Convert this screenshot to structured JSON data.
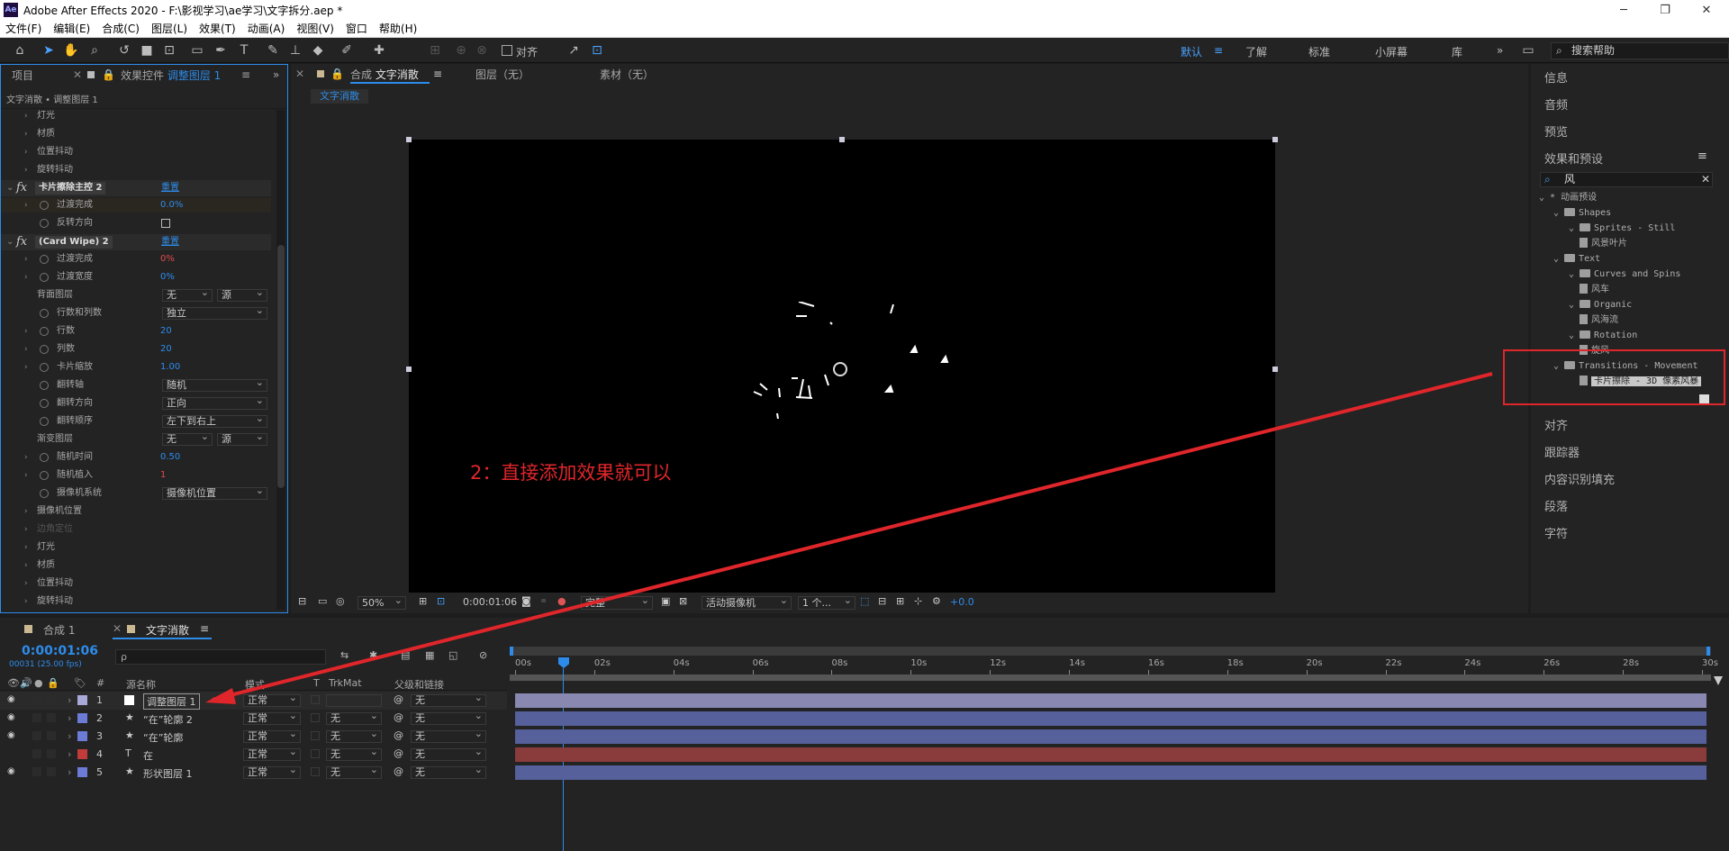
{
  "window": {
    "title": "Adobe After Effects 2020 - F:\\影视学习\\ae学习\\文字拆分.aep *",
    "logo": "Ae",
    "controls": [
      "minimize-icon",
      "restore-icon",
      "close-icon"
    ]
  },
  "menu": [
    "文件(F)",
    "编辑(E)",
    "合成(C)",
    "图层(L)",
    "效果(T)",
    "动画(A)",
    "视图(V)",
    "窗口",
    "帮助(H)"
  ],
  "toolbar": {
    "align_label": "对齐",
    "workspaces": [
      "默认",
      "了解",
      "标准",
      "小屏幕",
      "库"
    ],
    "search_help_placeholder": "搜索帮助"
  },
  "left_panel": {
    "tab_project": "项目",
    "tab_effects_prefix": "效果控件",
    "tab_effects_layer": "调整图层 1",
    "breadcrumb": "文字消散 • 调整图层 1",
    "props_top": [
      "灯光",
      "材质",
      "位置抖动",
      "旋转抖动"
    ],
    "fx1": {
      "name": "卡片擦除主控 2",
      "reset": "重置",
      "completion_label": "过渡完成",
      "completion_value": "0.0%",
      "reverse_label": "反转方向"
    },
    "fx2": {
      "name": "(Card Wipe) 2",
      "reset": "重置",
      "rows": [
        {
          "label": "过渡完成",
          "value": "0%",
          "type": "red"
        },
        {
          "label": "过渡宽度",
          "value": "0%",
          "type": "val"
        },
        {
          "label": "背面图层",
          "dd1": "无",
          "dd2": "源"
        },
        {
          "label": "行数和列数",
          "dd": "独立"
        },
        {
          "label": "行数",
          "value": "20",
          "type": "val"
        },
        {
          "label": "列数",
          "value": "20",
          "type": "val"
        },
        {
          "label": "卡片缩放",
          "value": "1.00",
          "type": "val"
        },
        {
          "label": "翻转轴",
          "dd": "随机"
        },
        {
          "label": "翻转方向",
          "dd": "正向"
        },
        {
          "label": "翻转顺序",
          "dd": "左下到右上"
        },
        {
          "label": "渐变图层",
          "dd1": "无",
          "dd2": "源"
        },
        {
          "label": "随机时间",
          "value": "0.50",
          "type": "val"
        },
        {
          "label": "随机植入",
          "value": "1",
          "type": "red"
        },
        {
          "label": "摄像机系统",
          "dd": "摄像机位置"
        }
      ],
      "props_after": [
        "摄像机位置",
        "边角定位",
        "灯光",
        "材质",
        "位置抖动",
        "旋转抖动"
      ]
    }
  },
  "comp_panel": {
    "tab_prefix": "合成",
    "tab_comp": "文字消散",
    "tab_layer": "图层（无）",
    "tab_footage": "素材（无）",
    "sub_tab": "文字消散",
    "annotation": "2：直接添加效果就可以",
    "footer": {
      "zoom": "50%",
      "timecode": "0:00:01:06",
      "resolution": "完整",
      "camera": "活动摄像机",
      "views": "1 个...",
      "exposure": "+0.0"
    }
  },
  "right_panel": {
    "items_top": [
      "信息",
      "音频",
      "预览"
    ],
    "effects_title": "效果和预设",
    "search_value": "风",
    "tree": [
      {
        "label": "* 动画预设",
        "kind": "root"
      },
      {
        "label": "Shapes",
        "kind": "folder"
      },
      {
        "label": "Sprites - Still",
        "kind": "folder"
      },
      {
        "label": "风景叶片",
        "kind": "preset"
      },
      {
        "label": "Text",
        "kind": "folder"
      },
      {
        "label": "Curves and Spins",
        "kind": "folder"
      },
      {
        "label": "风车",
        "kind": "preset"
      },
      {
        "label": "Organic",
        "kind": "folder"
      },
      {
        "label": "风海流",
        "kind": "preset"
      },
      {
        "label": "Rotation",
        "kind": "folder"
      },
      {
        "label": "旋风",
        "kind": "preset"
      },
      {
        "label": "Transitions - Movement",
        "kind": "folder"
      },
      {
        "label": "卡片擦除 - 3D 像素风暴",
        "kind": "preset"
      }
    ],
    "items_bottom": [
      "对齐",
      "跟踪器",
      "内容识别填充",
      "段落",
      "字符"
    ]
  },
  "timeline": {
    "tab1": "合成 1",
    "tab2": "文字消散",
    "timecode": "0:00:01:06",
    "frame_info": "00031 (25.00 fps)",
    "search_placeholder": "ρ",
    "headers": {
      "source": "源名称",
      "mode": "模式",
      "t": "T",
      "trkmat": "TrkMat",
      "parent": "父级和链接",
      "num": "#"
    },
    "layers": [
      {
        "num": "1",
        "name": "调整图层 1",
        "mode": "正常",
        "trkmat": "",
        "parent": "无",
        "color": "#a9a9d8",
        "icon": "white-square",
        "bar": "#8888b0"
      },
      {
        "num": "2",
        "name": "“在”轮廓 2",
        "mode": "正常",
        "trkmat": "无",
        "parent": "无",
        "color": "#6b7bd6",
        "icon": "star",
        "bar": "#56609a"
      },
      {
        "num": "3",
        "name": "“在”轮廓",
        "mode": "正常",
        "trkmat": "无",
        "parent": "无",
        "color": "#6b7bd6",
        "icon": "star",
        "bar": "#56609a"
      },
      {
        "num": "4",
        "name": "在",
        "mode": "正常",
        "trkmat": "无",
        "parent": "无",
        "color": "#c23b3b",
        "icon": "T",
        "bar": "#8a3c3c"
      },
      {
        "num": "5",
        "name": "形状图层 1",
        "mode": "正常",
        "trkmat": "无",
        "parent": "无",
        "color": "#6b7bd6",
        "icon": "star",
        "bar": "#56609a"
      }
    ],
    "ticks": [
      "00s",
      "02s",
      "04s",
      "06s",
      "08s",
      "10s",
      "12s",
      "14s",
      "16s",
      "18s",
      "20s",
      "22s",
      "24s",
      "26s",
      "28s",
      "30s"
    ]
  },
  "colors": {
    "accent": "#2d8ceb",
    "annotation": "#e0262b",
    "highlight": "#e0262b"
  }
}
